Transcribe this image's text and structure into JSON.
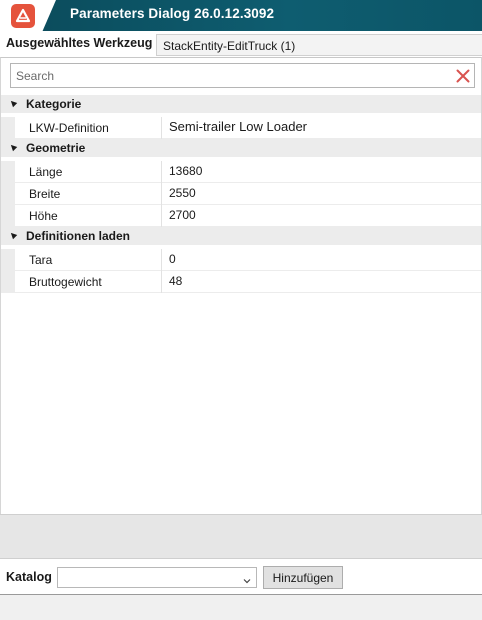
{
  "window": {
    "title": "Parameters Dialog 26.0.12.3092",
    "accent_color": "#0e5d70",
    "icon": "app-logo-icon"
  },
  "tool": {
    "label": "Ausgewähltes Werkzeug",
    "selected": "StackEntity-EditTruck (1)"
  },
  "search": {
    "placeholder": "Search",
    "value": "",
    "clear_icon": "close-icon"
  },
  "categories": [
    {
      "name": "Kategorie",
      "properties": [
        {
          "name": "LKW-Definition",
          "value": "Semi-trailer Low Loader"
        }
      ]
    },
    {
      "name": "Geometrie",
      "properties": [
        {
          "name": "Länge",
          "value": "13680"
        },
        {
          "name": "Breite",
          "value": "2550"
        },
        {
          "name": "Höhe",
          "value": "2700"
        }
      ]
    },
    {
      "name": "Definitionen laden",
      "properties": [
        {
          "name": "Tara",
          "value": "0"
        },
        {
          "name": "Bruttogewicht",
          "value": "48"
        }
      ]
    }
  ],
  "catalog": {
    "label": "Katalog",
    "selected": "",
    "add_label": "Hinzufügen"
  }
}
